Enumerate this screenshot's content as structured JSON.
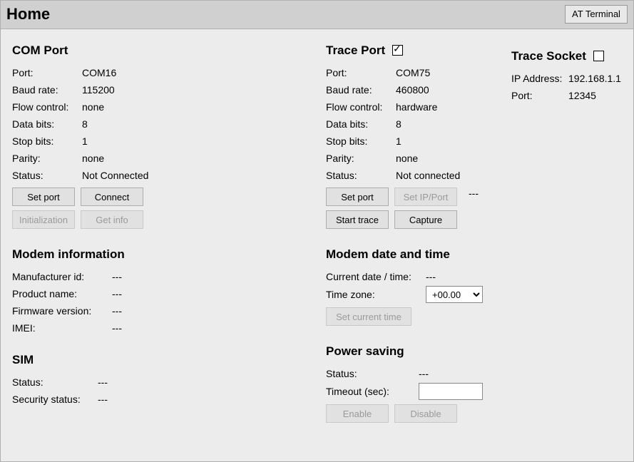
{
  "title": "Home",
  "at_terminal": "AT Terminal",
  "com_port": {
    "heading": "COM Port",
    "labels": {
      "port": "Port:",
      "baud": "Baud rate:",
      "flow": "Flow control:",
      "databits": "Data bits:",
      "stopbits": "Stop bits:",
      "parity": "Parity:",
      "status": "Status:"
    },
    "values": {
      "port": "COM16",
      "baud": "115200",
      "flow": "none",
      "databits": "8",
      "stopbits": "1",
      "parity": "none",
      "status": "Not Connected"
    },
    "buttons": {
      "set_port": "Set port",
      "connect": "Connect",
      "init": "Initialization",
      "get_info": "Get info"
    }
  },
  "trace_port": {
    "heading": "Trace Port",
    "checked": true,
    "labels": {
      "port": "Port:",
      "baud": "Baud rate:",
      "flow": "Flow control:",
      "databits": "Data bits:",
      "stopbits": "Stop bits:",
      "parity": "Parity:",
      "status": "Status:"
    },
    "values": {
      "port": "COM75",
      "baud": "460800",
      "flow": "hardware",
      "databits": "8",
      "stopbits": "1",
      "parity": "none",
      "status": "Not connected"
    },
    "buttons": {
      "set_port": "Set port",
      "set_ip": "Set IP/Port",
      "start_trace": "Start trace",
      "capture": "Capture"
    },
    "ip_dash": "---"
  },
  "trace_socket": {
    "heading": "Trace Socket",
    "checked": false,
    "labels": {
      "ip": "IP Address:",
      "port": "Port:"
    },
    "values": {
      "ip": "192.168.1.1",
      "port": "12345"
    }
  },
  "modem_info": {
    "heading": "Modem information",
    "labels": {
      "manuf": "Manufacturer id:",
      "product": "Product name:",
      "firmware": "Firmware version:",
      "imei": "IMEI:"
    },
    "values": {
      "manuf": "---",
      "product": "---",
      "firmware": "---",
      "imei": "---"
    }
  },
  "modem_datetime": {
    "heading": "Modem date and time",
    "labels": {
      "current": "Current date / time:",
      "tz": "Time zone:"
    },
    "values": {
      "current": "---",
      "tz": "+00.00"
    },
    "buttons": {
      "set_time": "Set current time"
    }
  },
  "sim": {
    "heading": "SIM",
    "labels": {
      "status": "Status:",
      "security": "Security status:"
    },
    "values": {
      "status": "---",
      "security": "---"
    }
  },
  "power": {
    "heading": "Power saving",
    "labels": {
      "status": "Status:",
      "timeout": "Timeout (sec):"
    },
    "values": {
      "status": "---",
      "timeout": ""
    },
    "buttons": {
      "enable": "Enable",
      "disable": "Disable"
    }
  }
}
